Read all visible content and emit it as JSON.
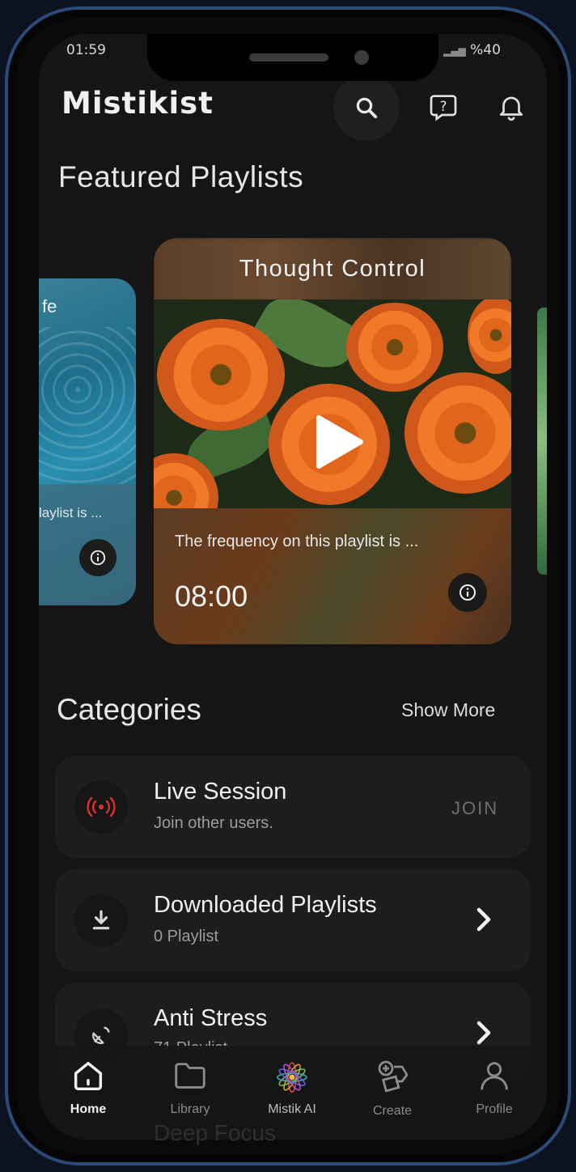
{
  "status_bar": {
    "time": "01:59",
    "battery": "%40"
  },
  "header": {
    "brand": "Mistikist"
  },
  "featured": {
    "title": "Featured Playlists",
    "left_card": {
      "title_fragment": "fe",
      "desc_fragment": "laylist is ..."
    },
    "main_card": {
      "title": "Thought Control",
      "description": "The frequency on this playlist is ...",
      "duration": "08:00"
    }
  },
  "categories": {
    "title": "Categories",
    "show_more": "Show More",
    "items": [
      {
        "title": "Live Session",
        "subtitle": "Join other users.",
        "action": "JOIN"
      },
      {
        "title": "Downloaded Playlists",
        "subtitle": "0 Playlist"
      },
      {
        "title": "Anti Stress",
        "subtitle": "71 Playlist"
      }
    ],
    "hidden_item_fragment": "Deep Focus"
  },
  "tabs": [
    {
      "label": "Home",
      "active": true
    },
    {
      "label": "Library"
    },
    {
      "label": "Mistik AI"
    },
    {
      "label": "Create"
    },
    {
      "label": "Profile"
    }
  ],
  "colors": {
    "background": "#151515",
    "bezel": "#2a4a78",
    "live_red": "#e0302a",
    "accent_text": "#f0f0f0"
  }
}
